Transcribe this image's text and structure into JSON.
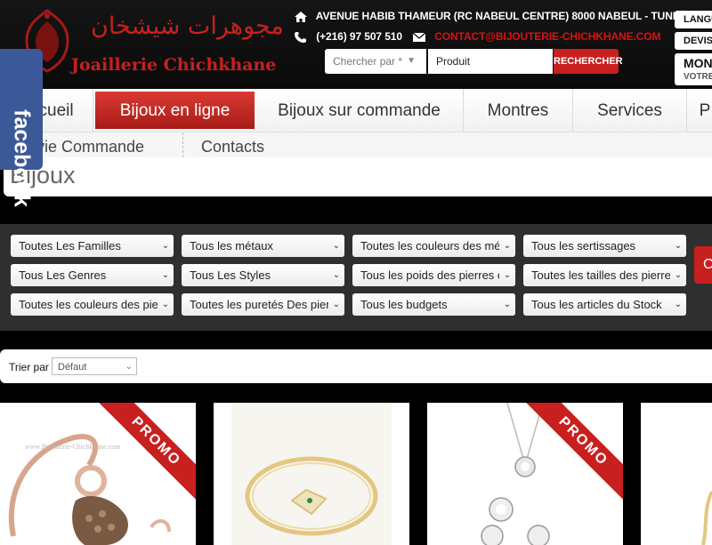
{
  "header": {
    "logo_arabic": "مجوهرات شيشخان",
    "logo_latin": "Joaillerie Chichkhane",
    "address": "Avenue Habib Thameur (RC Nabeul Centre) 8000 Nabeul - Tunisie",
    "phone": "(+216) 97 507 510",
    "email": "contact@bijouterie-chichkhane.com",
    "icons": {
      "address": "home-icon",
      "phone": "phone-icon",
      "email": "mail-icon"
    }
  },
  "search": {
    "category_placeholder": "Chercher par *",
    "input_value": "Produit",
    "button_label": "RECHERCHER"
  },
  "top_right": {
    "language_label": "LANGU",
    "currency_label": "DEVISE",
    "account_title": "MON",
    "account_sub": "VOTRE"
  },
  "nav": {
    "items": [
      "Accueil",
      "Bijoux en ligne",
      "Bijoux sur commande",
      "Montres",
      "Services",
      "P"
    ],
    "active_index": 1
  },
  "subnav": {
    "items": [
      "Suivie Commande",
      "Contacts"
    ]
  },
  "page_title": "Bijoux",
  "filters": {
    "row1": [
      "Toutes Les Familles",
      "Tous les métaux",
      "Toutes les couleurs des métaux",
      "Tous les sertissages"
    ],
    "row2": [
      "Tous Les Genres",
      "Tous Les Styles",
      "Tous les poids des pierres centrales",
      "Toutes les tailles des pierres"
    ],
    "row3": [
      "Toutes les couleurs des pierres",
      "Toutes les puretés Des pierres",
      "Tous les budgets",
      "Tous les articles du Stock"
    ],
    "button_label": "C"
  },
  "sort": {
    "label": "Trier par",
    "value": "Défaut"
  },
  "products": [
    {
      "promo": "PROMO",
      "watermark": "www.Bijouterie-Chichkhane.com"
    },
    {
      "promo": ""
    },
    {
      "promo": "PROMO"
    }
  ],
  "facebook_label": "facebook",
  "colors": {
    "brand_red": "#c8201f",
    "facebook_blue": "#3b5998",
    "panel_dark": "#2f2f2f"
  }
}
